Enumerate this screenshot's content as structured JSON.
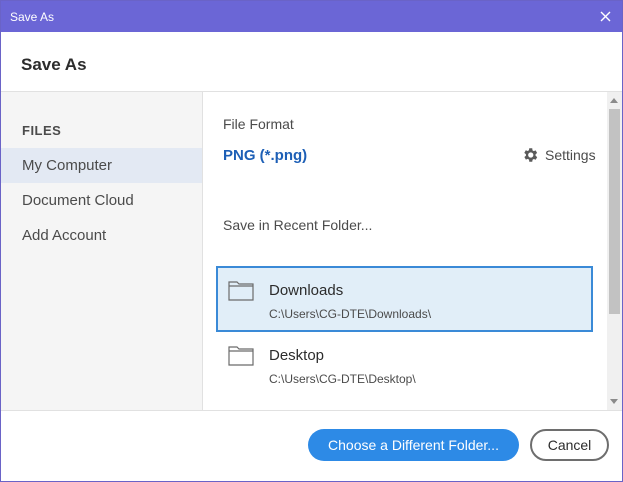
{
  "window": {
    "title": "Save As"
  },
  "header": {
    "heading": "Save As"
  },
  "sidebar": {
    "section_label": "FILES",
    "items": [
      {
        "label": "My Computer",
        "active": true
      },
      {
        "label": "Document Cloud",
        "active": false
      },
      {
        "label": "Add Account",
        "active": false
      }
    ]
  },
  "main": {
    "format_label": "File Format",
    "format_value": "PNG (*.png)",
    "settings_label": "Settings",
    "recent_label": "Save in Recent Folder...",
    "folders": [
      {
        "name": "Downloads",
        "path": "C:\\Users\\CG-DTE\\Downloads\\",
        "selected": true
      },
      {
        "name": "Desktop",
        "path": "C:\\Users\\CG-DTE\\Desktop\\",
        "selected": false
      }
    ]
  },
  "footer": {
    "primary_label": "Choose a Different Folder...",
    "cancel_label": "Cancel"
  },
  "colors": {
    "titlebar": "#6b66d6",
    "accent": "#2d8ae6",
    "link": "#1d5fb6",
    "selection_bg": "#e1eef8",
    "selection_border": "#3a8ad7"
  },
  "icons": [
    "close-icon",
    "gear-icon",
    "folder-icon",
    "scroll-up-icon",
    "scroll-down-icon"
  ]
}
